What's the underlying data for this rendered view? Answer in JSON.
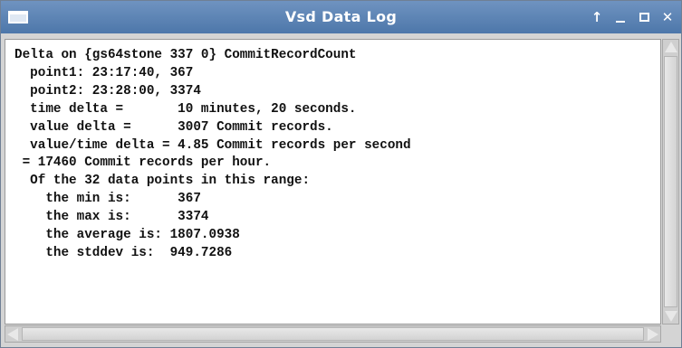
{
  "window": {
    "title": "Vsd Data Log",
    "menu_icon": "window-menu-icon",
    "controls": {
      "pin_icon": "up-arrow-icon",
      "pin_glyph": "↑",
      "minimize_icon": "minimize-icon",
      "maximize_icon": "maximize-icon",
      "close_icon": "close-icon",
      "close_glyph": "✕"
    }
  },
  "log": {
    "lines": [
      "Delta on {gs64stone 337 0} CommitRecordCount",
      "  point1: 23:17:40, 367",
      "  point2: 23:28:00, 3374",
      "  time delta =       10 minutes, 20 seconds.",
      "  value delta =      3007 Commit records.",
      "  value/time delta = 4.85 Commit records per second",
      " = 17460 Commit records per hour.",
      "  Of the 32 data points in this range:",
      "    the min is:      367",
      "    the max is:      3374",
      "    the average is: 1807.0938",
      "    the stddev is:  949.7286"
    ]
  },
  "colors": {
    "titlebar": "#5a82b4",
    "text": "#111111",
    "background": "#ffffff"
  }
}
